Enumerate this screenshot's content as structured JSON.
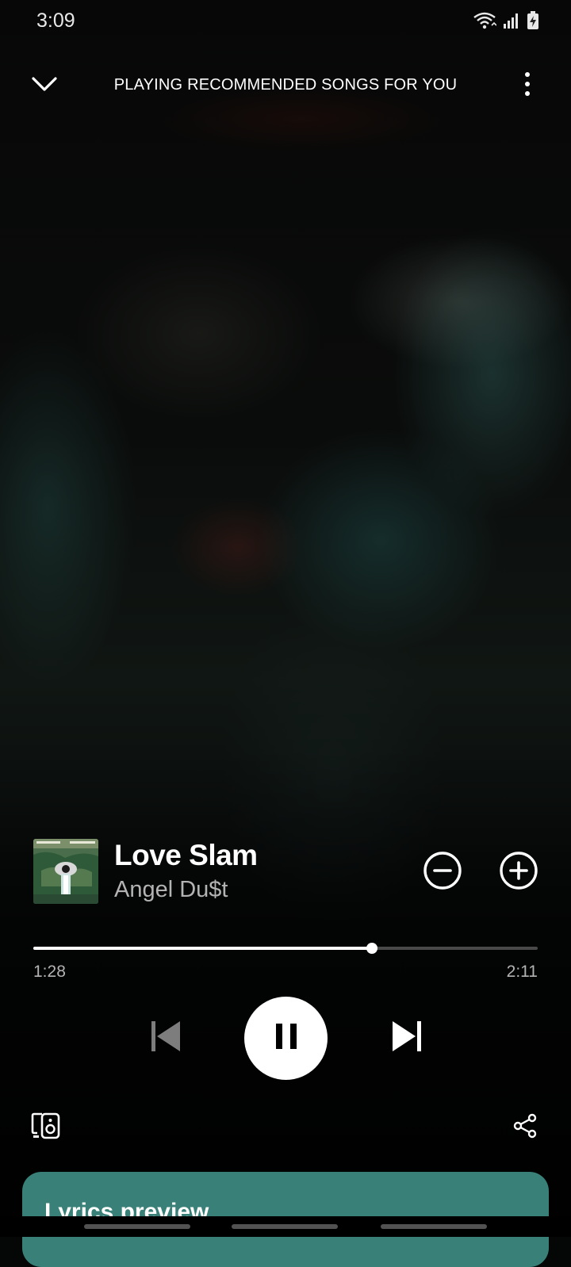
{
  "status_bar": {
    "time": "3:09",
    "icons": [
      "wifi-icon",
      "signal-icon",
      "battery-charging-icon"
    ]
  },
  "header": {
    "context_title": "PLAYING RECOMMENDED SONGS FOR YOU",
    "left_icon": "chevron-down-icon",
    "right_icon": "more-vertical-icon"
  },
  "track": {
    "title": "Love Slam",
    "artist": "Angel Du$t",
    "cover_icon": "album-cover"
  },
  "progress": {
    "elapsed": "1:28",
    "total": "2:11",
    "fraction": 0.672
  },
  "controls": {
    "previous_icon": "skip-previous-icon",
    "play_state_icon": "pause-icon",
    "next_icon": "skip-next-icon",
    "dislike_icon": "minus-circle-icon",
    "add_icon": "plus-circle-icon",
    "devices_icon": "connect-devices-icon",
    "share_icon": "share-icon"
  },
  "lyrics": {
    "title": "Lyrics preview"
  },
  "colors": {
    "lyrics_card": "#388078",
    "accent_white": "#ffffff",
    "secondary_text": "#b3b3b3"
  }
}
